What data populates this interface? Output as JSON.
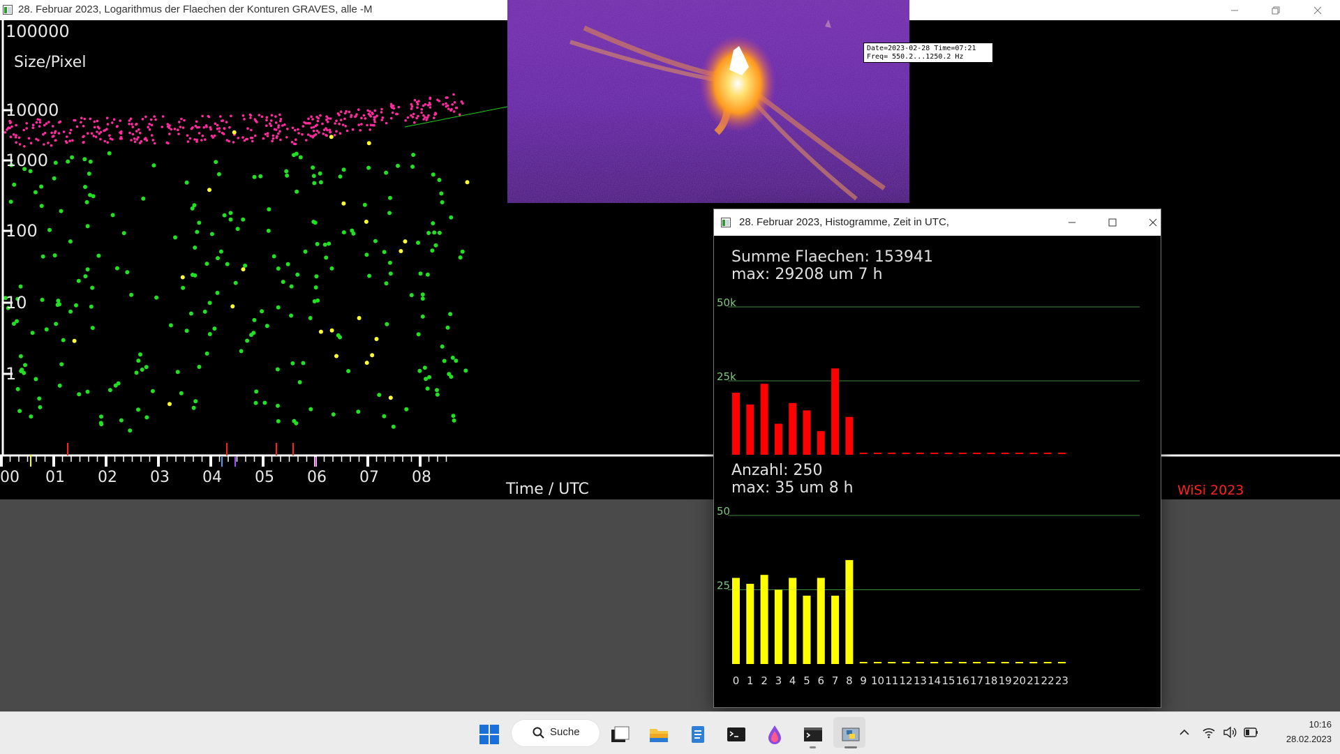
{
  "main_window": {
    "title": "28. Februar 2023, Logarithmus der Flaechen der Konturen GRAVES, alle -M",
    "minimize_icon": "minimize-icon",
    "restore_icon": "restore-icon",
    "close_icon": "close-icon"
  },
  "scatter_plot": {
    "y_tick_labels": [
      "100000",
      "10000",
      "1000",
      "100",
      "10",
      "1"
    ],
    "y_axis_label": "Size/Pixel",
    "x_tick_labels": [
      "00",
      "01",
      "02",
      "03",
      "04",
      "05",
      "06",
      "07",
      "08"
    ],
    "x_axis_label": "Time / UTC",
    "signature": "WiSi 2023",
    "colors": {
      "background": "#000000",
      "green_points": "#22e022",
      "magenta_points": "#ff2aa0",
      "yellow_points": "#ffff30",
      "axis": "#ffffff",
      "signature": "#ff2020"
    }
  },
  "spectrum_overlay": {
    "info_line1": "Date=2023-02-28 Time=07:21",
    "info_line2": "Freq= 550.2...1250.2 Hz"
  },
  "hist_window": {
    "title": "28. Februar 2023, Histogramme, Zeit in UTC,",
    "minimize_icon": "minimize-icon",
    "maximize_icon": "maximize-icon",
    "close_icon": "close-icon"
  },
  "chart_data": [
    {
      "type": "bar",
      "title_line1": "Summe Flaechen: 153941",
      "title_line2": "max: 29208 um 7 h",
      "categories": [
        "0",
        "1",
        "2",
        "3",
        "4",
        "5",
        "6",
        "7",
        "8",
        "9",
        "10",
        "11",
        "12",
        "13",
        "14",
        "15",
        "16",
        "17",
        "18",
        "19",
        "20",
        "21",
        "22",
        "23"
      ],
      "values": [
        21000,
        17000,
        24000,
        10500,
        17500,
        15000,
        8000,
        29208,
        12800,
        0,
        0,
        0,
        0,
        0,
        0,
        0,
        0,
        0,
        0,
        0,
        0,
        0,
        0,
        0
      ],
      "gridlines": [
        {
          "value": 50000,
          "label": "50k"
        },
        {
          "value": 25000,
          "label": "25k"
        }
      ],
      "ylim": [
        0,
        50000
      ],
      "bar_color": "#ff0000",
      "grid_color": "#3b8a3b"
    },
    {
      "type": "bar",
      "title_line1": "Anzahl: 250",
      "title_line2": "max: 35 um 8 h",
      "categories": [
        "0",
        "1",
        "2",
        "3",
        "4",
        "5",
        "6",
        "7",
        "8",
        "9",
        "10",
        "11",
        "12",
        "13",
        "14",
        "15",
        "16",
        "17",
        "18",
        "19",
        "20",
        "21",
        "22",
        "23"
      ],
      "values": [
        29,
        27,
        30,
        25,
        29,
        23,
        29,
        23,
        35,
        0,
        0,
        0,
        0,
        0,
        0,
        0,
        0,
        0,
        0,
        0,
        0,
        0,
        0,
        0
      ],
      "gridlines": [
        {
          "value": 50,
          "label": "50"
        },
        {
          "value": 25,
          "label": "25"
        }
      ],
      "ylim": [
        0,
        50
      ],
      "bar_color": "#ffff00",
      "grid_color": "#3b8a3b"
    }
  ],
  "taskbar": {
    "start_icon": "windows-start-icon",
    "search_icon": "search-icon",
    "search_label": "Suche",
    "apps": [
      "task-view-icon",
      "file-explorer-icon",
      "notepad-icon",
      "terminal-icon",
      "paint-drop-icon",
      "command-prompt-icon",
      "python-app-icon"
    ],
    "tray_icons": [
      "chevron-up-icon",
      "wifi-icon",
      "volume-icon",
      "battery-icon"
    ],
    "time": "10:16",
    "date": "28.02.2023"
  }
}
